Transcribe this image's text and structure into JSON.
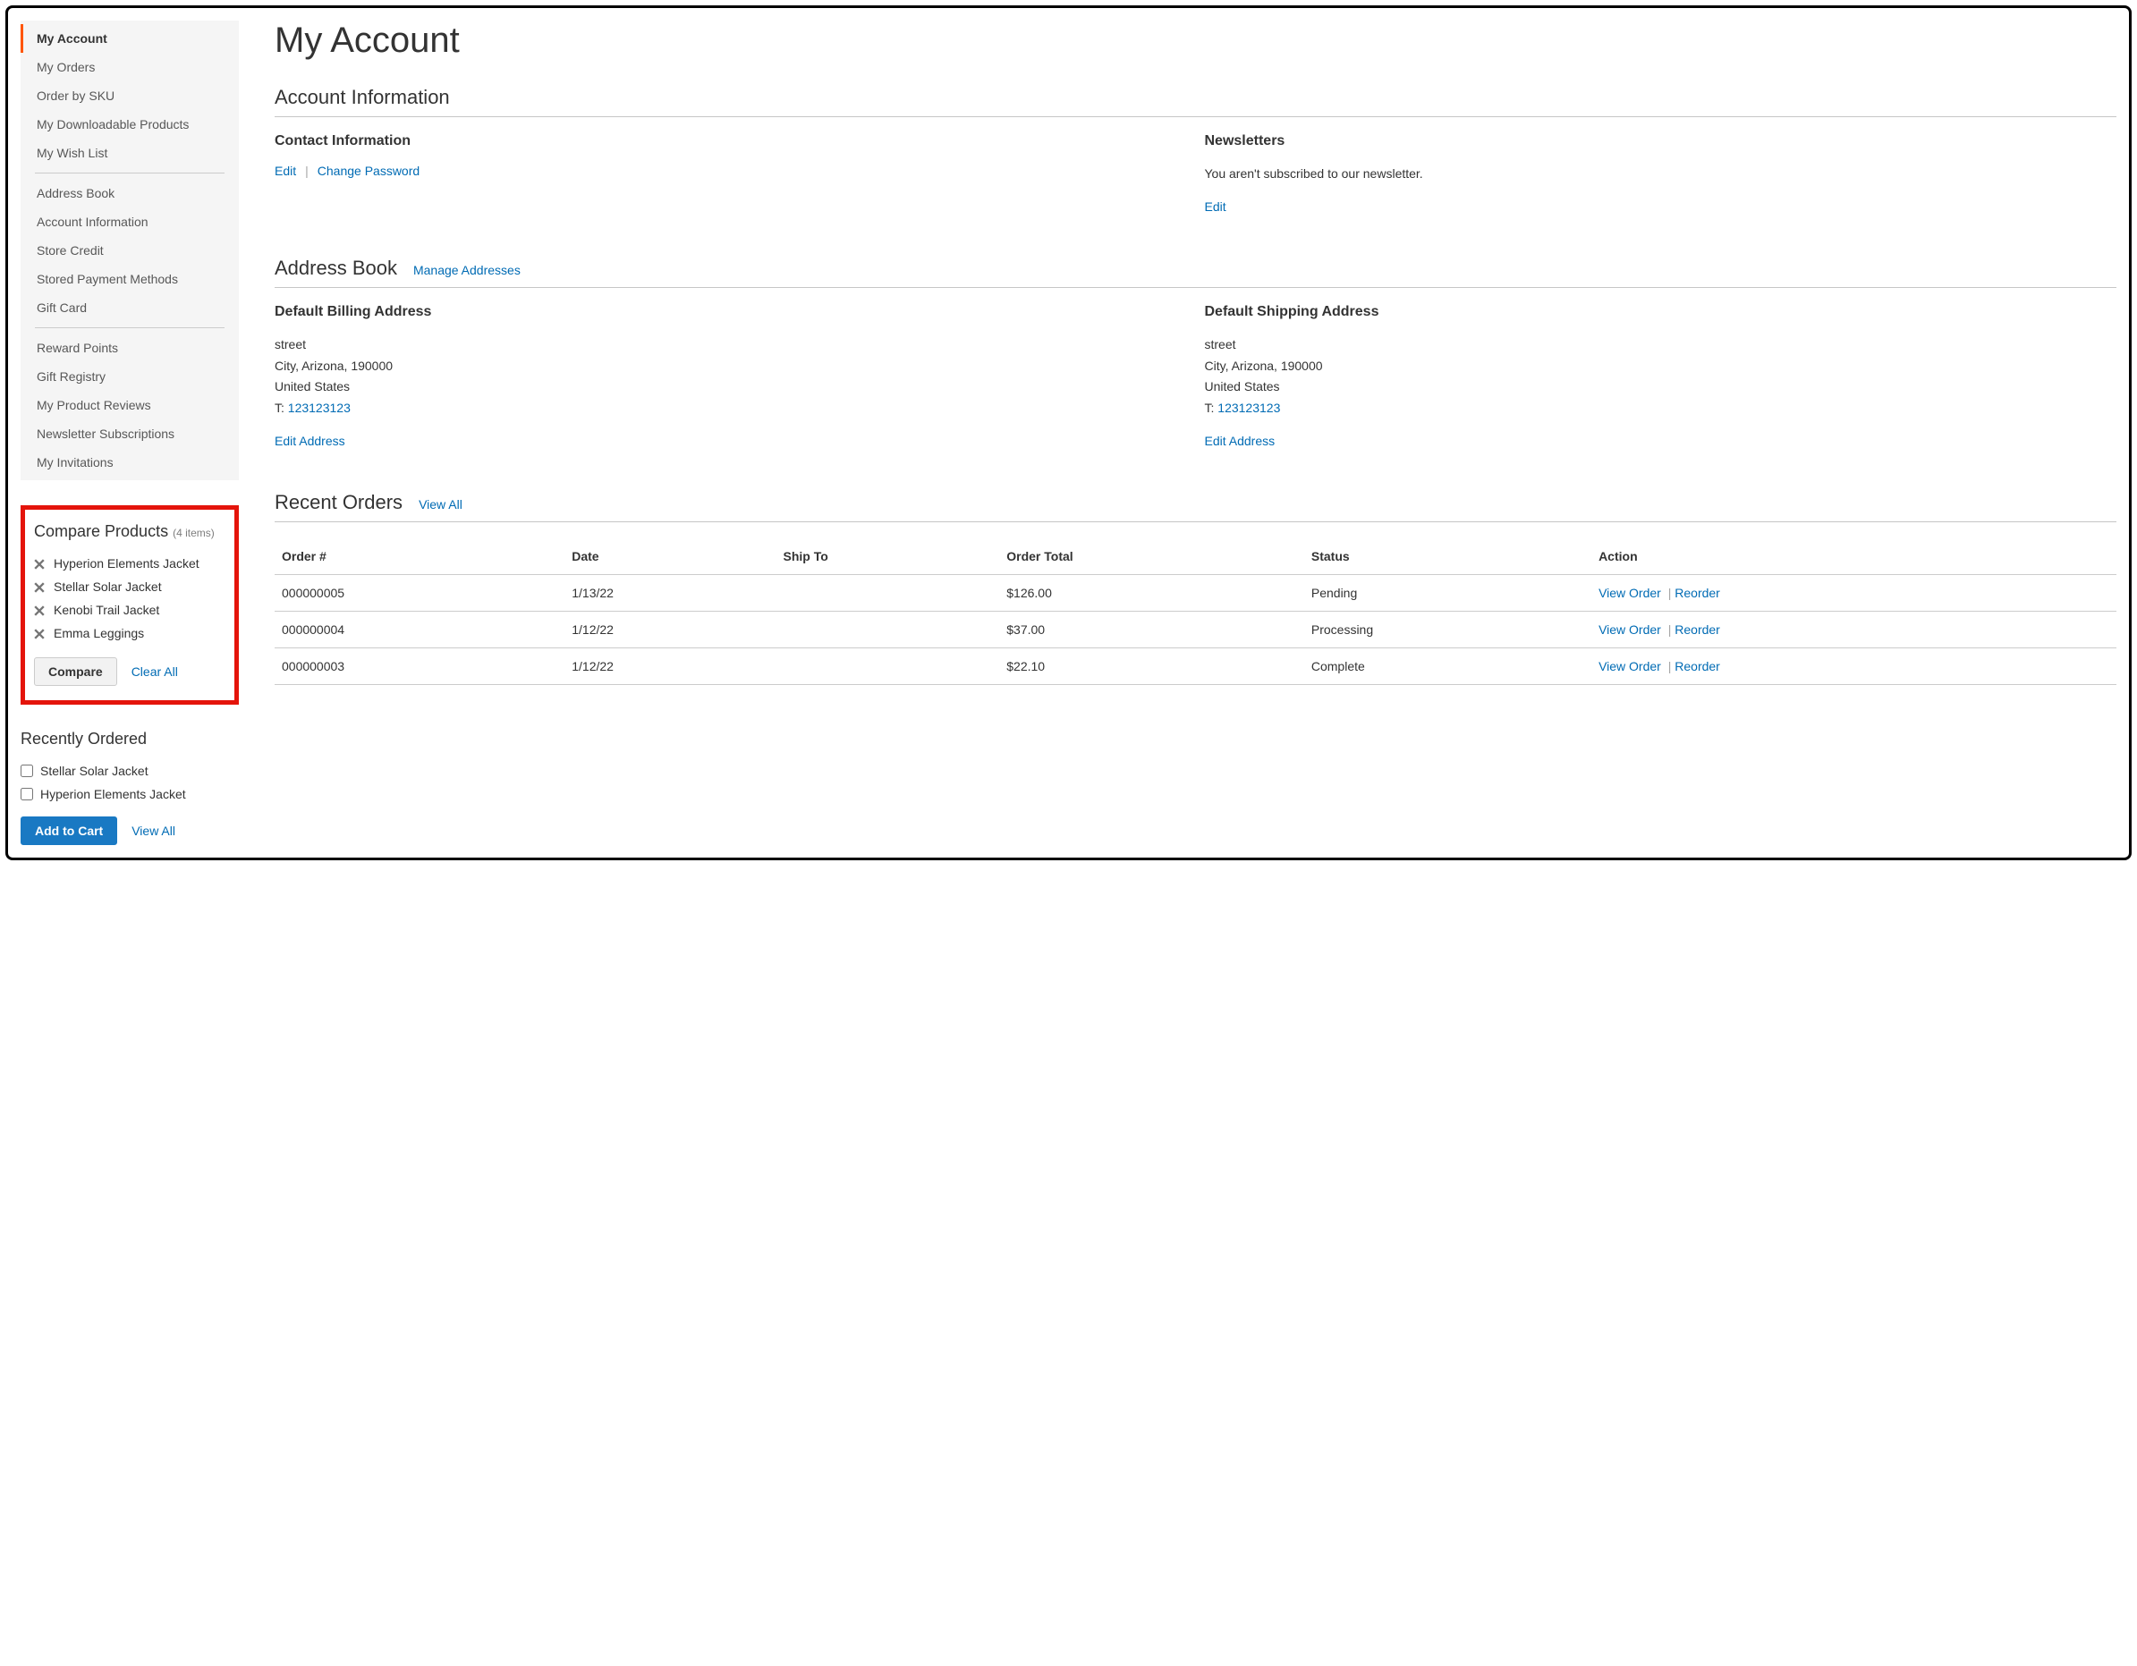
{
  "sidebar": {
    "nav": [
      {
        "label": "My Account",
        "current": true
      },
      {
        "label": "My Orders"
      },
      {
        "label": "Order by SKU"
      },
      {
        "label": "My Downloadable Products"
      },
      {
        "label": "My Wish List"
      },
      {
        "sep": true
      },
      {
        "label": "Address Book"
      },
      {
        "label": "Account Information"
      },
      {
        "label": "Store Credit"
      },
      {
        "label": "Stored Payment Methods"
      },
      {
        "label": "Gift Card"
      },
      {
        "sep": true
      },
      {
        "label": "Reward Points"
      },
      {
        "label": "Gift Registry"
      },
      {
        "label": "My Product Reviews"
      },
      {
        "label": "Newsletter Subscriptions"
      },
      {
        "label": "My Invitations"
      }
    ]
  },
  "compare": {
    "title": "Compare Products",
    "count_label": "(4 items)",
    "items": [
      "Hyperion Elements Jacket",
      "Stellar Solar Jacket",
      "Kenobi Trail Jacket",
      "Emma Leggings"
    ],
    "compare_btn": "Compare",
    "clear_all": "Clear All"
  },
  "recent_ord_block": {
    "title": "Recently Ordered",
    "items": [
      "Stellar Solar Jacket",
      "Hyperion Elements Jacket"
    ],
    "add_btn": "Add to Cart",
    "view_all": "View All"
  },
  "page": {
    "title": "My Account",
    "account_info": {
      "heading": "Account Information",
      "contact": {
        "title": "Contact Information",
        "edit": "Edit",
        "change_pw": "Change Password"
      },
      "newsletter": {
        "title": "Newsletters",
        "status": "You aren't subscribed to our newsletter.",
        "edit": "Edit"
      }
    },
    "address_book": {
      "heading": "Address Book",
      "manage": "Manage Addresses",
      "billing": {
        "title": "Default Billing Address",
        "line1": "street",
        "line2": "City, Arizona, 190000",
        "line3": "United States",
        "phone_prefix": "T: ",
        "phone": "123123123",
        "edit": "Edit Address"
      },
      "shipping": {
        "title": "Default Shipping Address",
        "line1": "street",
        "line2": "City, Arizona, 190000",
        "line3": "United States",
        "phone_prefix": "T: ",
        "phone": "123123123",
        "edit": "Edit Address"
      }
    },
    "recent_orders": {
      "heading": "Recent Orders",
      "view_all": "View All",
      "columns": [
        "Order #",
        "Date",
        "Ship To",
        "Order Total",
        "Status",
        "Action"
      ],
      "rows": [
        {
          "order": "000000005",
          "date": "1/13/22",
          "ship": "",
          "total": "$126.00",
          "status": "Pending",
          "view": "View Order",
          "reorder": "Reorder"
        },
        {
          "order": "000000004",
          "date": "1/12/22",
          "ship": "",
          "total": "$37.00",
          "status": "Processing",
          "view": "View Order",
          "reorder": "Reorder"
        },
        {
          "order": "000000003",
          "date": "1/12/22",
          "ship": "",
          "total": "$22.10",
          "status": "Complete",
          "view": "View Order",
          "reorder": "Reorder"
        }
      ]
    }
  }
}
